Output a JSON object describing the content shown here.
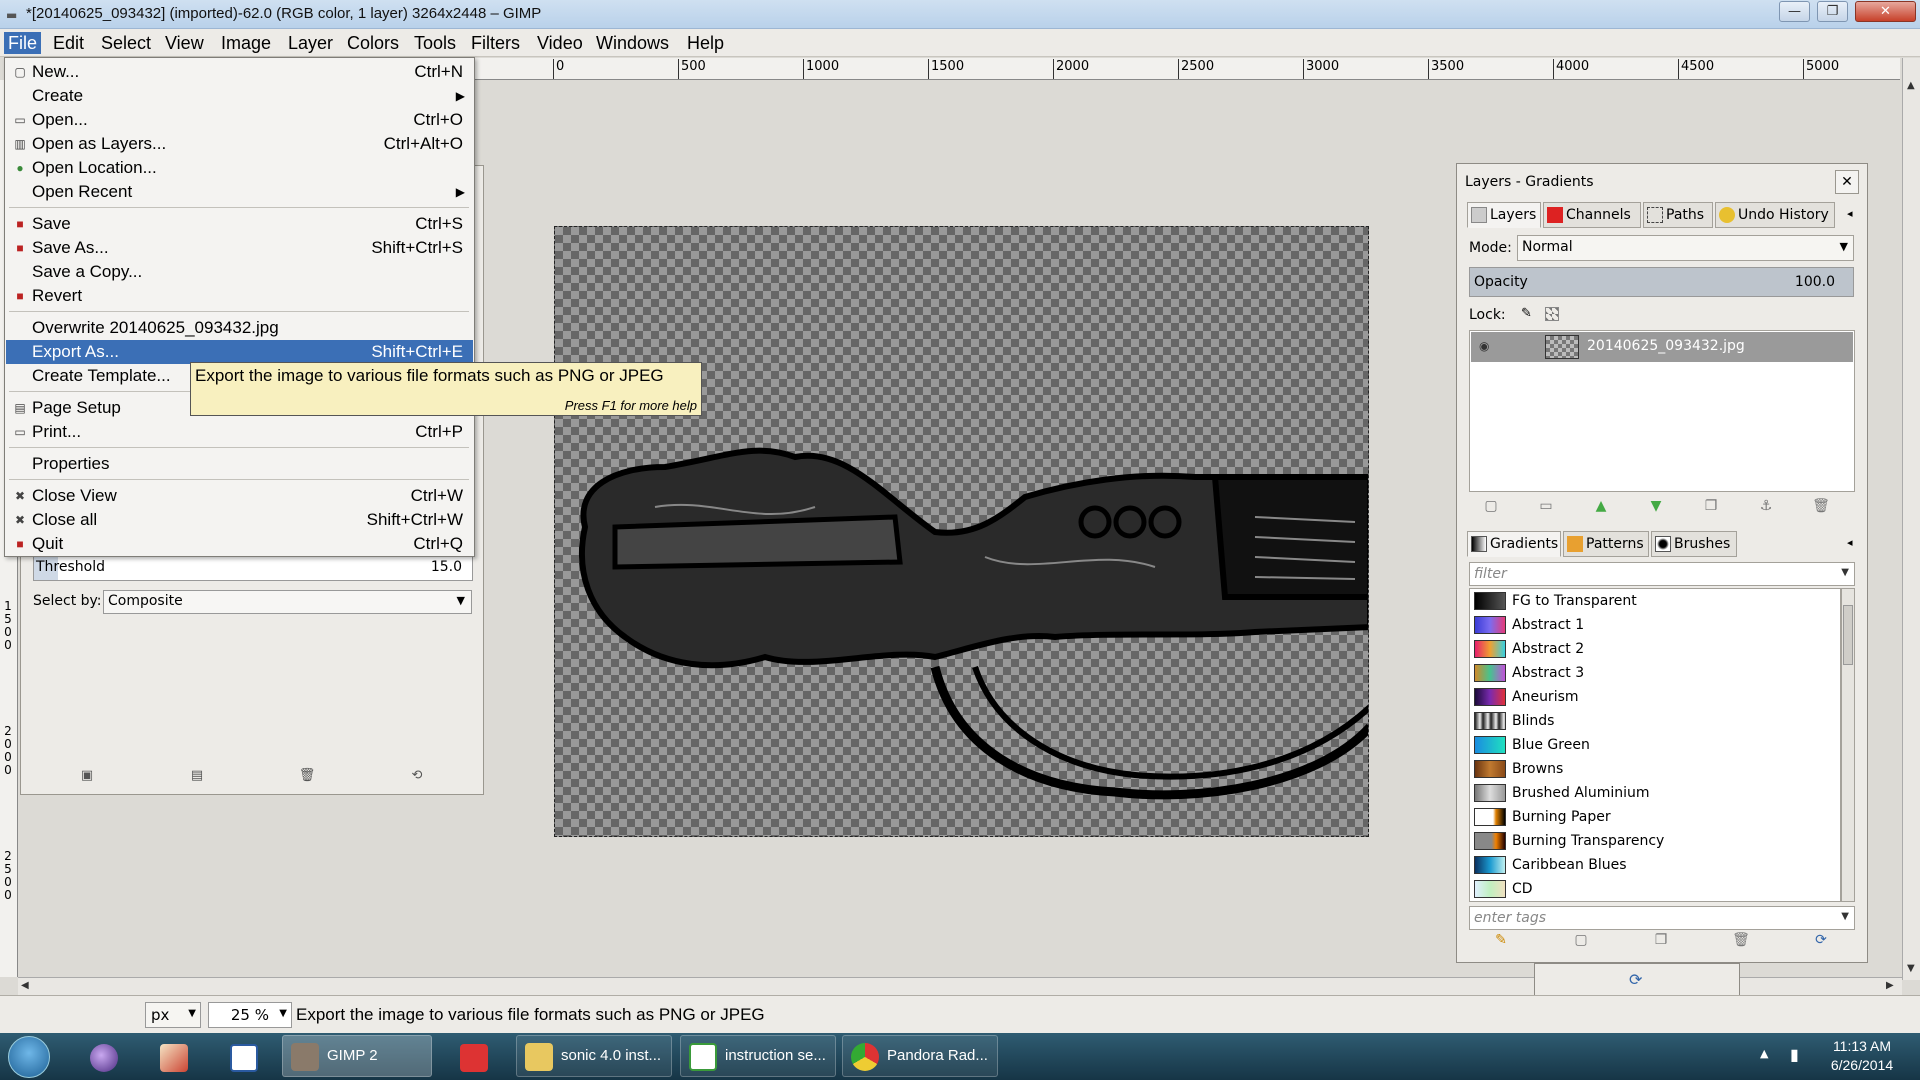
{
  "window": {
    "title": "*[20140625_093432] (imported)-62.0 (RGB color, 1 layer) 3264x2448 – GIMP",
    "min_label": "—",
    "max_label": "❐",
    "close_label": "✕"
  },
  "menubar": [
    "File",
    "Edit",
    "Select",
    "View",
    "Image",
    "Layer",
    "Colors",
    "Tools",
    "Filters",
    "Video",
    "Windows",
    "Help"
  ],
  "ruler": {
    "top_labels": [
      "0",
      "500",
      "1000",
      "1500",
      "2000",
      "2500",
      "3000",
      "3500",
      "4000",
      "4500",
      "5000"
    ],
    "left_labels": [
      "1500",
      "2000",
      "2500"
    ]
  },
  "file_menu": {
    "items": [
      {
        "label": "New...",
        "accel": "Ctrl+N",
        "icon": "new-doc"
      },
      {
        "label": "Create",
        "accel": "",
        "submenu": true
      },
      {
        "label": "Open...",
        "accel": "Ctrl+O",
        "icon": "folder"
      },
      {
        "label": "Open as Layers...",
        "accel": "Ctrl+Alt+O",
        "icon": "layers"
      },
      {
        "label": "Open Location...",
        "accel": "",
        "icon": "globe"
      },
      {
        "label": "Open Recent",
        "accel": "",
        "submenu": true
      },
      {
        "label": "Save",
        "accel": "Ctrl+S",
        "icon": "floppy"
      },
      {
        "label": "Save As...",
        "accel": "Shift+Ctrl+S",
        "icon": "floppy"
      },
      {
        "label": "Save a Copy...",
        "accel": ""
      },
      {
        "label": "Revert",
        "accel": "",
        "icon": "revert"
      },
      {
        "label": "Overwrite 20140625_093432.jpg",
        "accel": ""
      },
      {
        "label": "Export As...",
        "accel": "Shift+Ctrl+E",
        "highlighted": true
      },
      {
        "label": "Create Template...",
        "accel": ""
      },
      {
        "label": "Page Setup",
        "accel": "",
        "icon": "page-setup"
      },
      {
        "label": "Print...",
        "accel": "Ctrl+P",
        "icon": "printer"
      },
      {
        "label": "Properties",
        "accel": ""
      },
      {
        "label": "Close View",
        "accel": "Ctrl+W",
        "icon": "close"
      },
      {
        "label": "Close all",
        "accel": "Shift+Ctrl+W",
        "icon": "close"
      },
      {
        "label": "Quit",
        "accel": "Ctrl+Q",
        "icon": "quit"
      }
    ]
  },
  "tooltip": {
    "text": "Export the image to various file formats such as PNG or JPEG",
    "hint": "Press F1 for more help"
  },
  "tool_options": {
    "threshold_label": "Threshold",
    "threshold_value": "15.0",
    "select_by_label": "Select by:",
    "select_by_value": "Composite"
  },
  "layers_dock": {
    "title": "Layers - Gradients",
    "tabs": [
      "Layers",
      "Channels",
      "Paths",
      "Undo History"
    ],
    "mode_label": "Mode:",
    "mode_value": "Normal",
    "opacity_label": "Opacity",
    "opacity_value": "100.0",
    "lock_label": "Lock:",
    "layer_name": "20140625_093432.jpg",
    "bottom_tabs": [
      "Gradients",
      "Patterns",
      "Brushes"
    ],
    "filter_placeholder": "filter",
    "tags_placeholder": "enter tags",
    "gradients": [
      {
        "name": "FG to Transparent",
        "css": "linear-gradient(90deg,#000,#555)"
      },
      {
        "name": "Abstract 1",
        "css": "linear-gradient(90deg,#3a3cd6,#7b6cf0,#e53b7a)"
      },
      {
        "name": "Abstract 2",
        "css": "linear-gradient(90deg,#e61f6c,#f0a030,#38d0e0)"
      },
      {
        "name": "Abstract 3",
        "css": "linear-gradient(90deg,#d08a2a,#46c38f,#c052d8)"
      },
      {
        "name": "Aneurism",
        "css": "linear-gradient(90deg,#1b0b3a,#7a2ab0,#e0303a)"
      },
      {
        "name": "Blinds",
        "css": "repeating-linear-gradient(90deg,#222 0,#eee 5px,#222 8px)"
      },
      {
        "name": "Blue Green",
        "css": "linear-gradient(90deg,#1a8ce0,#20e0c0)"
      },
      {
        "name": "Browns",
        "css": "linear-gradient(90deg,#6a3410,#c07a30,#8a4a18)"
      },
      {
        "name": "Brushed Aluminium",
        "css": "linear-gradient(90deg,#777,#ddd,#999)"
      },
      {
        "name": "Burning Paper",
        "css": "linear-gradient(90deg,#fff 60%,#e08000 70%,#000)"
      },
      {
        "name": "Burning Transparency",
        "css": "linear-gradient(90deg,#888 55%,#f08000 70%,#200)"
      },
      {
        "name": "Caribbean Blues",
        "css": "linear-gradient(90deg,#0a3060,#1a9ad0,#c0f0f0)"
      },
      {
        "name": "CD",
        "css": "linear-gradient(90deg,#e0f0ff,#c0f0c0,#f0e0c0)"
      }
    ]
  },
  "statusbar": {
    "unit": "px",
    "zoom": "25 %",
    "message": "Export the image to various file formats such as PNG or JPEG"
  },
  "taskbar": {
    "buttons": [
      "GIMP 2",
      "sonic 4.0 inst...",
      "instruction se...",
      "Pandora Rad..."
    ],
    "time": "11:13 AM",
    "date": "6/26/2014"
  }
}
